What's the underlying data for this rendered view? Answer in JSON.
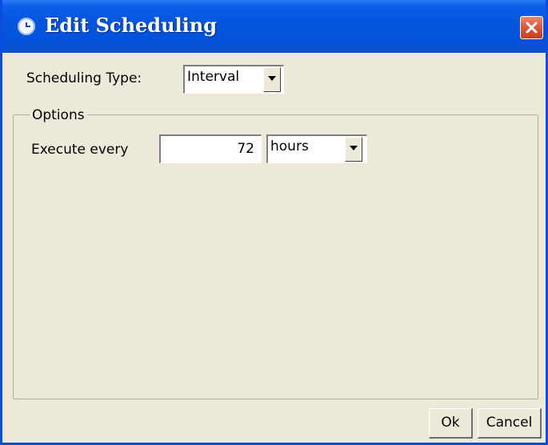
{
  "window": {
    "title": "Edit Scheduling",
    "title_icon": "clock-icon",
    "close_icon": "close-icon"
  },
  "scheduling": {
    "type_label": "Scheduling Type:",
    "type_value": "Interval"
  },
  "options": {
    "group_title": "Options",
    "execute_label": "Execute every",
    "interval_value": "72",
    "unit_value": "hours"
  },
  "buttons": {
    "ok": "Ok",
    "cancel": "Cancel"
  },
  "colors": {
    "titlebar": "#0655de",
    "dialog_background": "#ece9d8",
    "close_button": "#dd5a3c"
  }
}
